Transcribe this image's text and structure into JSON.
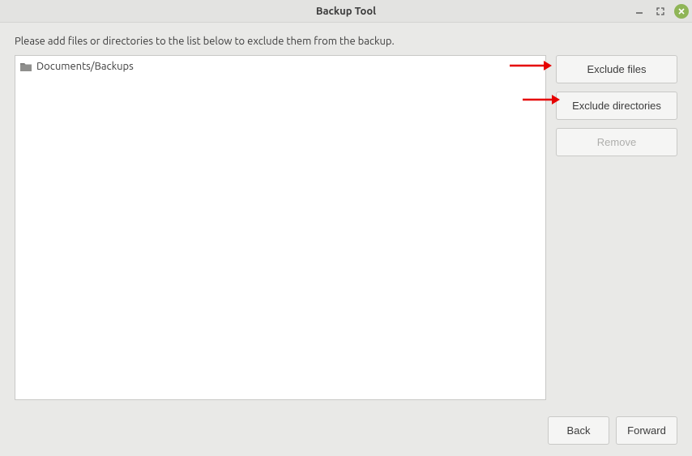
{
  "window": {
    "title": "Backup Tool"
  },
  "instruction": "Please add files or directories to the list below to exclude them from the backup.",
  "list": {
    "items": [
      {
        "label": "Documents/Backups",
        "icon": "folder-icon"
      }
    ]
  },
  "side_buttons": {
    "exclude_files": "Exclude files",
    "exclude_directories": "Exclude directories",
    "remove": "Remove"
  },
  "footer": {
    "back": "Back",
    "forward": "Forward"
  }
}
